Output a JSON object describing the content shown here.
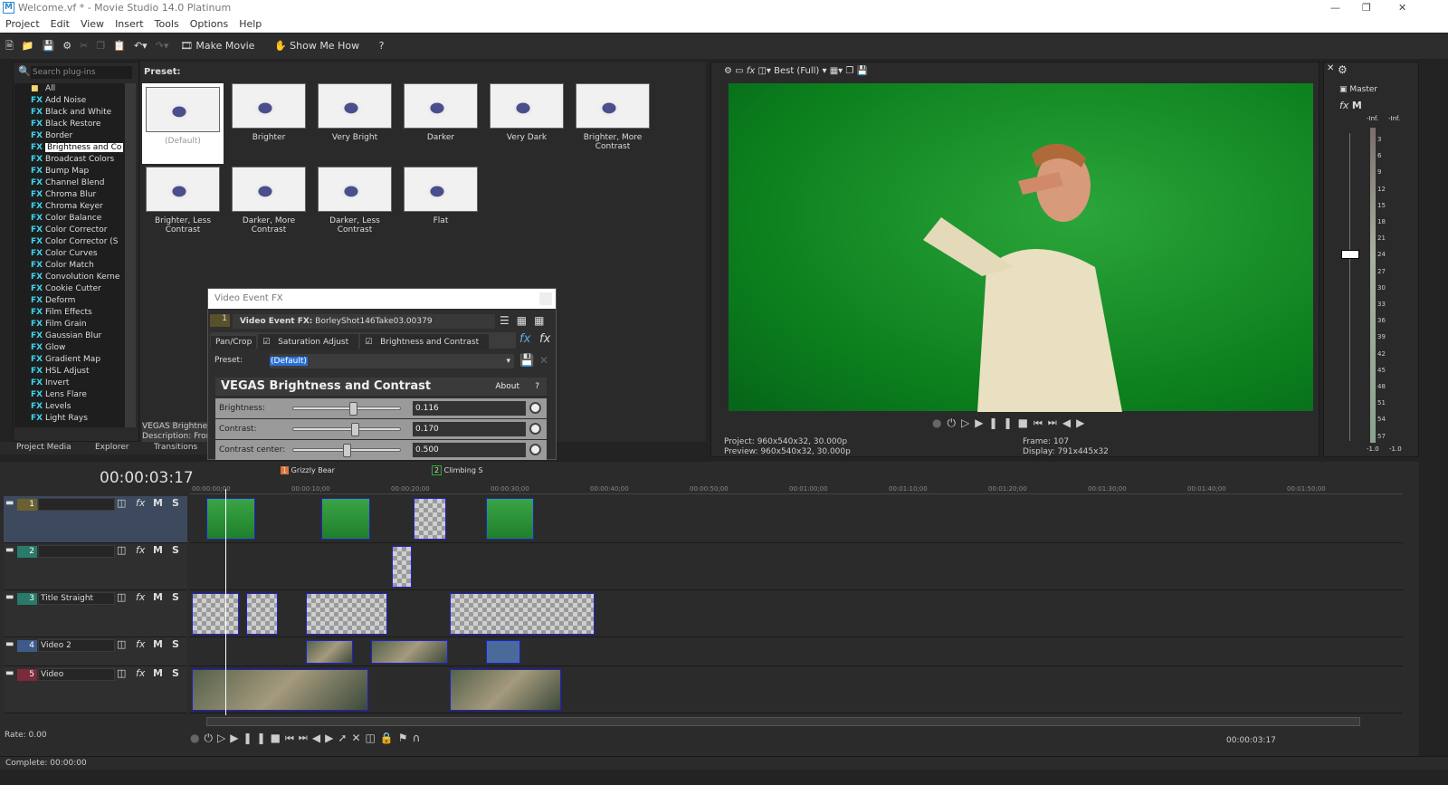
{
  "window": {
    "title": "Welcome.vf * - Movie Studio 14.0 Platinum",
    "logo": "M"
  },
  "menu": [
    "Project",
    "Edit",
    "View",
    "Insert",
    "Tools",
    "Options",
    "Help"
  ],
  "toolbar": {
    "make_movie": "Make Movie",
    "show_me_how": "Show Me How"
  },
  "plugins": {
    "search_placeholder": "Search plug-ins",
    "root": "All",
    "selected": "Brightness and Contrast",
    "items": [
      "Add Noise",
      "Black and White",
      "Black Restore",
      "Border",
      "Brightness and Co",
      "Broadcast Colors",
      "Bump Map",
      "Channel Blend",
      "Chroma Blur",
      "Chroma Keyer",
      "Color Balance",
      "Color Corrector",
      "Color Corrector (S",
      "Color Curves",
      "Color Match",
      "Convolution Kerne",
      "Cookie Cutter",
      "Deform",
      "Film Effects",
      "Film Grain",
      "Gaussian Blur",
      "Glow",
      "Gradient Map",
      "HSL Adjust",
      "Invert",
      "Lens Flare",
      "Levels",
      "Light Rays"
    ]
  },
  "presets": {
    "label": "Preset:",
    "items": [
      "(Default)",
      "Brighter",
      "Very Bright",
      "Darker",
      "Very Dark",
      "Brighter, More Contrast",
      "Brighter, Less Contrast",
      "Darker, More Contrast",
      "Darker, Less Contrast",
      "Flat"
    ],
    "description_title": "VEGAS Brightness",
    "description": "Description: From I"
  },
  "tabs": [
    "Project Media",
    "Explorer",
    "Transitions"
  ],
  "dialog": {
    "title": "Video Event FX",
    "index": "1",
    "fx_label": "Video Event FX:",
    "fx_name": "BorleyShot146Take03.00379",
    "chain": [
      "Pan/Crop",
      "Saturation Adjust",
      "Brightness and Contrast"
    ],
    "preset_label": "Preset:",
    "preset_value": "(Default)",
    "plugin_title": "VEGAS Brightness and Contrast",
    "about": "About",
    "help": "?",
    "params": [
      {
        "label": "Brightness:",
        "value": "0.116",
        "fraction": 0.56
      },
      {
        "label": "Contrast:",
        "value": "0.170",
        "fraction": 0.58
      },
      {
        "label": "Contrast center:",
        "value": "0.500",
        "fraction": 0.5
      }
    ]
  },
  "preview": {
    "quality": "Best (Full)",
    "project_label": "Project:",
    "project": "960x540x32, 30.000p",
    "preview_label": "Preview:",
    "preview": "960x540x32, 30.000p",
    "frame_label": "Frame:",
    "frame": "107",
    "display_label": "Display:",
    "display": "791x445x32"
  },
  "mixer": {
    "label": "Master",
    "inf_left": "-Inf.",
    "inf_right": "-Inf.",
    "ticks": [
      "3",
      "6",
      "9",
      "12",
      "15",
      "18",
      "21",
      "24",
      "27",
      "30",
      "33",
      "36",
      "39",
      "42",
      "45",
      "48",
      "51",
      "54",
      "57"
    ],
    "bottom_left": "-1.0",
    "bottom_right": "-1.0"
  },
  "timeline": {
    "timecode": "00:00:03:17",
    "ruler": [
      "00:00:00;00",
      "00:00:10;00",
      "00:00:20;00",
      "00:00:30;00",
      "00:00:40;00",
      "00:00:50;00",
      "00:01:00;00",
      "00:01:10;00",
      "00:01:20;00",
      "00:01:30;00",
      "00:01:40;00",
      "00:01:50;00"
    ],
    "markers": [
      {
        "num": "1",
        "label": "Grizzly Bear"
      },
      {
        "num": "2",
        "label": "Climbing S"
      }
    ],
    "tracks": [
      {
        "num": "1",
        "name": "",
        "color": "#6b6130"
      },
      {
        "num": "2",
        "name": "",
        "color": "#2a7a6a"
      },
      {
        "num": "3",
        "name": "Title Straight",
        "color": "#2a7a6a"
      },
      {
        "num": "4",
        "name": "Video 2",
        "color": "#3e5a8a"
      },
      {
        "num": "5",
        "name": "Video",
        "color": "#7a2a3a"
      }
    ],
    "rate": "Rate: 0.00",
    "end_timecode": "00:00:03:17"
  },
  "status": "Complete: 00:00:00"
}
